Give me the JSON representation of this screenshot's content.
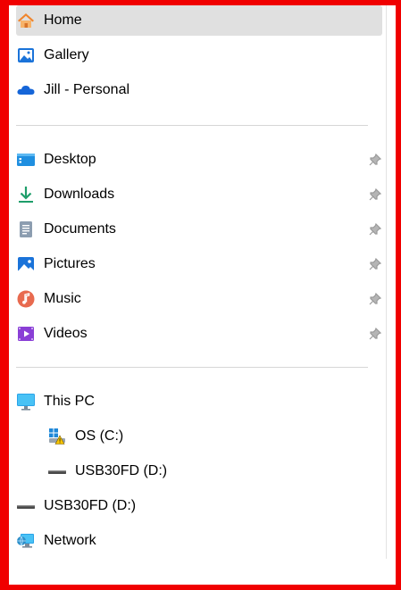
{
  "nav": {
    "top": [
      {
        "label": "Home",
        "icon": "home-icon",
        "selected": true
      },
      {
        "label": "Gallery",
        "icon": "gallery-icon"
      },
      {
        "label": "Jill - Personal",
        "icon": "onedrive-cloud-icon"
      }
    ],
    "quick_access": [
      {
        "label": "Desktop",
        "icon": "desktop-folder-icon",
        "pinned": true
      },
      {
        "label": "Downloads",
        "icon": "download-arrow-icon",
        "pinned": true
      },
      {
        "label": "Documents",
        "icon": "documents-icon",
        "pinned": true
      },
      {
        "label": "Pictures",
        "icon": "pictures-icon",
        "pinned": true
      },
      {
        "label": "Music",
        "icon": "music-icon",
        "pinned": true
      },
      {
        "label": "Videos",
        "icon": "videos-icon",
        "pinned": true
      }
    ],
    "drives": [
      {
        "label": "This PC",
        "icon": "monitor-icon"
      },
      {
        "label": "OS (C:)",
        "icon": "windows-drive-icon"
      },
      {
        "label": "USB30FD (D:)",
        "icon": "usb-drive-icon"
      },
      {
        "label": "USB30FD (D:)",
        "icon": "usb-drive-icon"
      },
      {
        "label": "Network",
        "icon": "network-icon"
      }
    ]
  },
  "colors": {
    "frame": "#f00000",
    "selected_bg": "#e0e0e0",
    "accent": "#0078d4"
  }
}
